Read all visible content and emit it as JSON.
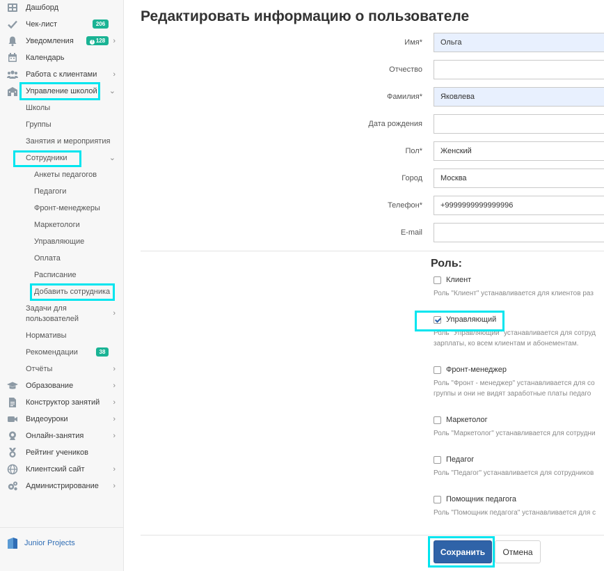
{
  "sidebar": {
    "items": [
      {
        "label": "Дашборд",
        "icon": "dashboard-icon"
      },
      {
        "label": "Чек-лист",
        "icon": "check-icon",
        "badge": "206"
      },
      {
        "label": "Уведомления",
        "icon": "bell-icon",
        "badge": "128"
      },
      {
        "label": "Календарь",
        "icon": "calendar-icon"
      },
      {
        "label": "Работа с клиентами",
        "icon": "users-icon"
      },
      {
        "label": "Управление школой",
        "icon": "school-icon"
      },
      {
        "label": "Школы"
      },
      {
        "label": "Группы"
      },
      {
        "label": "Занятия и мероприятия"
      },
      {
        "label": "Сотрудники"
      },
      {
        "label": "Анкеты педагогов"
      },
      {
        "label": "Педагоги"
      },
      {
        "label": "Фронт-менеджеры"
      },
      {
        "label": "Маркетологи"
      },
      {
        "label": "Управляющие"
      },
      {
        "label": "Оплата"
      },
      {
        "label": "Расписание"
      },
      {
        "label": "Добавить сотрудника"
      },
      {
        "label": "Задачи для",
        "label2": "пользователей"
      },
      {
        "label": "Нормативы"
      },
      {
        "label": "Рекомендации",
        "badge": "38"
      },
      {
        "label": "Отчёты"
      },
      {
        "label": "Образование",
        "icon": "graduation-cap-icon"
      },
      {
        "label": "Конструктор занятий",
        "icon": "document-icon"
      },
      {
        "label": "Видеоуроки",
        "icon": "video-camera-icon"
      },
      {
        "label": "Онлайн-занятия",
        "icon": "webcam-icon"
      },
      {
        "label": "Рейтинг учеников",
        "icon": "medal-icon"
      },
      {
        "label": "Клиентский сайт",
        "icon": "globe-icon"
      },
      {
        "label": "Администрирование",
        "icon": "gears-icon"
      }
    ],
    "brand": "Junior Projects"
  },
  "page": {
    "title": "Редактировать информацию о пользователе"
  },
  "form": {
    "fields": [
      {
        "label": "Имя*",
        "value": "Ольга"
      },
      {
        "label": "Отчество",
        "value": ""
      },
      {
        "label": "Фамилия*",
        "value": "Яковлева"
      },
      {
        "label": "Дата рождения",
        "value": ""
      },
      {
        "label": "Пол*",
        "value": "Женский"
      },
      {
        "label": "Город",
        "value": "Москва"
      },
      {
        "label": "Телефон*",
        "value": "+9999999999999996"
      },
      {
        "label": "E-mail",
        "value": ""
      }
    ]
  },
  "roles": {
    "title": "Роль:",
    "items": [
      {
        "name": "Клиент",
        "checked": false,
        "desc": [
          "Роль \"Клиент\" устанавливается для клиентов раз"
        ]
      },
      {
        "name": "Управляющий",
        "checked": true,
        "desc": [
          "Роль \"Управляющий\" устанавливается для сотруд",
          "зарплаты, ко всем клиентам и абонементам."
        ]
      },
      {
        "name": "Фронт-менеджер",
        "checked": false,
        "desc": [
          "Роль \"Фронт - менеджер\" устанавливается для со",
          "группы и они не видят заработные платы педаго"
        ]
      },
      {
        "name": "Маркетолог",
        "checked": false,
        "desc": [
          "Роль \"Маркетолог\" устанавливается для сотрудни"
        ]
      },
      {
        "name": "Педагог",
        "checked": false,
        "desc": [
          "Роль \"Педагог\" устанавливается для сотрудников"
        ]
      },
      {
        "name": "Помощник педагога",
        "checked": false,
        "desc": [
          "Роль \"Помощник педагога\" устанавливается для с"
        ]
      }
    ]
  },
  "actions": {
    "save": "Сохранить",
    "cancel": "Отмена"
  },
  "colors": {
    "accent": "#1ab394",
    "primary_button": "#2f63a8",
    "highlight": "#00e5ef",
    "autofill": "#e8f0fe"
  }
}
